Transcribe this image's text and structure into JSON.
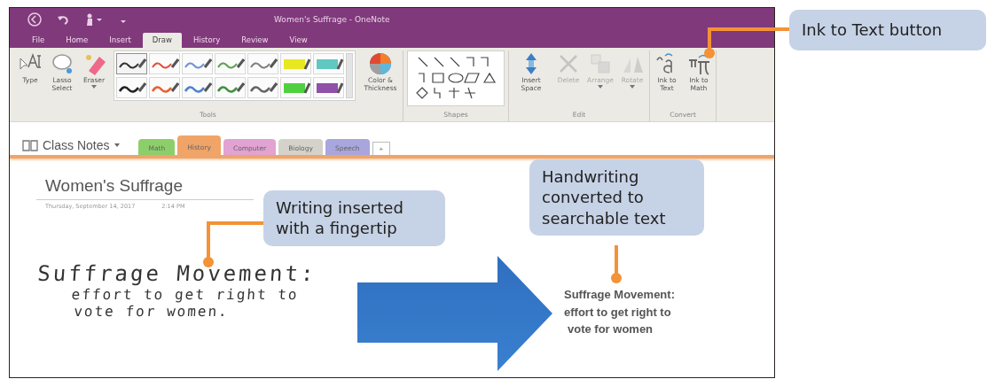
{
  "window": {
    "title": "Women's Suffrage - OneNote"
  },
  "ribbon_tabs": [
    {
      "label": "File",
      "selected": false
    },
    {
      "label": "Home",
      "selected": false
    },
    {
      "label": "Insert",
      "selected": false
    },
    {
      "label": "Draw",
      "selected": true
    },
    {
      "label": "History",
      "selected": false
    },
    {
      "label": "Review",
      "selected": false
    },
    {
      "label": "View",
      "selected": false
    }
  ],
  "ribbon_groups": [
    {
      "label": "Tools",
      "items": [
        {
          "kind": "type",
          "label": "Type",
          "disabled": false,
          "has_menu": false
        },
        {
          "kind": "lasso",
          "label": "Lasso Select",
          "disabled": false,
          "has_menu": false
        },
        {
          "kind": "eraser",
          "label": "Eraser",
          "disabled": false,
          "has_menu": true
        },
        {
          "kind": "gallery",
          "pens": [
            {
              "kind": "pen",
              "color": "#333333",
              "selected": true
            },
            {
              "kind": "pen",
              "color": "#e05040",
              "selected": false
            },
            {
              "kind": "pen",
              "color": "#7090d0",
              "selected": false
            },
            {
              "kind": "pen",
              "color": "#60a050",
              "selected": false
            },
            {
              "kind": "pen",
              "color": "#808080",
              "selected": false
            },
            {
              "kind": "highlighter",
              "color": "#e8e820",
              "selected": false
            },
            {
              "kind": "highlighter",
              "color": "#60c8c0",
              "selected": false
            },
            {
              "kind": "pen",
              "color": "#222222",
              "selected": false
            },
            {
              "kind": "pen",
              "color": "#e86030",
              "selected": false
            },
            {
              "kind": "pen",
              "color": "#5080d0",
              "selected": false
            },
            {
              "kind": "pen",
              "color": "#409040",
              "selected": false
            },
            {
              "kind": "pen",
              "color": "#666666",
              "selected": false
            },
            {
              "kind": "highlighter",
              "color": "#50d040",
              "selected": false
            },
            {
              "kind": "highlighter",
              "color": "#9050a8",
              "selected": false
            }
          ]
        },
        {
          "kind": "palette",
          "label": "Color & Thickness",
          "disabled": false,
          "has_menu": false
        }
      ]
    },
    {
      "label": "Shapes",
      "items": [
        {
          "kind": "shapes"
        }
      ]
    },
    {
      "label": "Edit",
      "items": [
        {
          "kind": "spacer",
          "label": "Insert Space",
          "disabled": false,
          "has_menu": false
        },
        {
          "kind": "delete",
          "label": "Delete",
          "disabled": true,
          "has_menu": false
        },
        {
          "kind": "arrange",
          "label": "Arrange",
          "disabled": true,
          "has_menu": true
        },
        {
          "kind": "rotate",
          "label": "Rotate",
          "disabled": true,
          "has_menu": true
        }
      ]
    },
    {
      "label": "Convert",
      "items": [
        {
          "kind": "text",
          "label": "Ink to Text",
          "disabled": false,
          "has_menu": false
        },
        {
          "kind": "math",
          "label": "Ink to Math",
          "disabled": false,
          "has_menu": false
        }
      ]
    }
  ],
  "notebook": {
    "name": "Class Notes"
  },
  "sections": [
    {
      "label": "Math",
      "color": "#8ccf6a",
      "selected": false
    },
    {
      "label": "History",
      "color": "#f0a468",
      "selected": true
    },
    {
      "label": "Computer",
      "color": "#e2a2d2",
      "selected": false
    },
    {
      "label": "Biology",
      "color": "#d4d2ca",
      "selected": false
    },
    {
      "label": "Speech",
      "color": "#a8a6dc",
      "selected": false
    }
  ],
  "add_section": "+",
  "page": {
    "title": "Women's Suffrage",
    "date": "Thursday, September 14, 2017",
    "time": "2:14 PM",
    "ink_lines": [
      "Suffrage Movement:",
      "effort to get right to",
      "vote for women."
    ],
    "converted_lines": [
      "Suffrage Movement:",
      "effort to get right to",
      "vote for women"
    ]
  },
  "callouts": [
    {
      "kind": "ribbon",
      "text": "Ink to Text button"
    },
    {
      "kind": "ink",
      "text": "Writing inserted with a fingertip"
    },
    {
      "kind": "converted",
      "text": "Handwriting converted to searchable text"
    }
  ]
}
